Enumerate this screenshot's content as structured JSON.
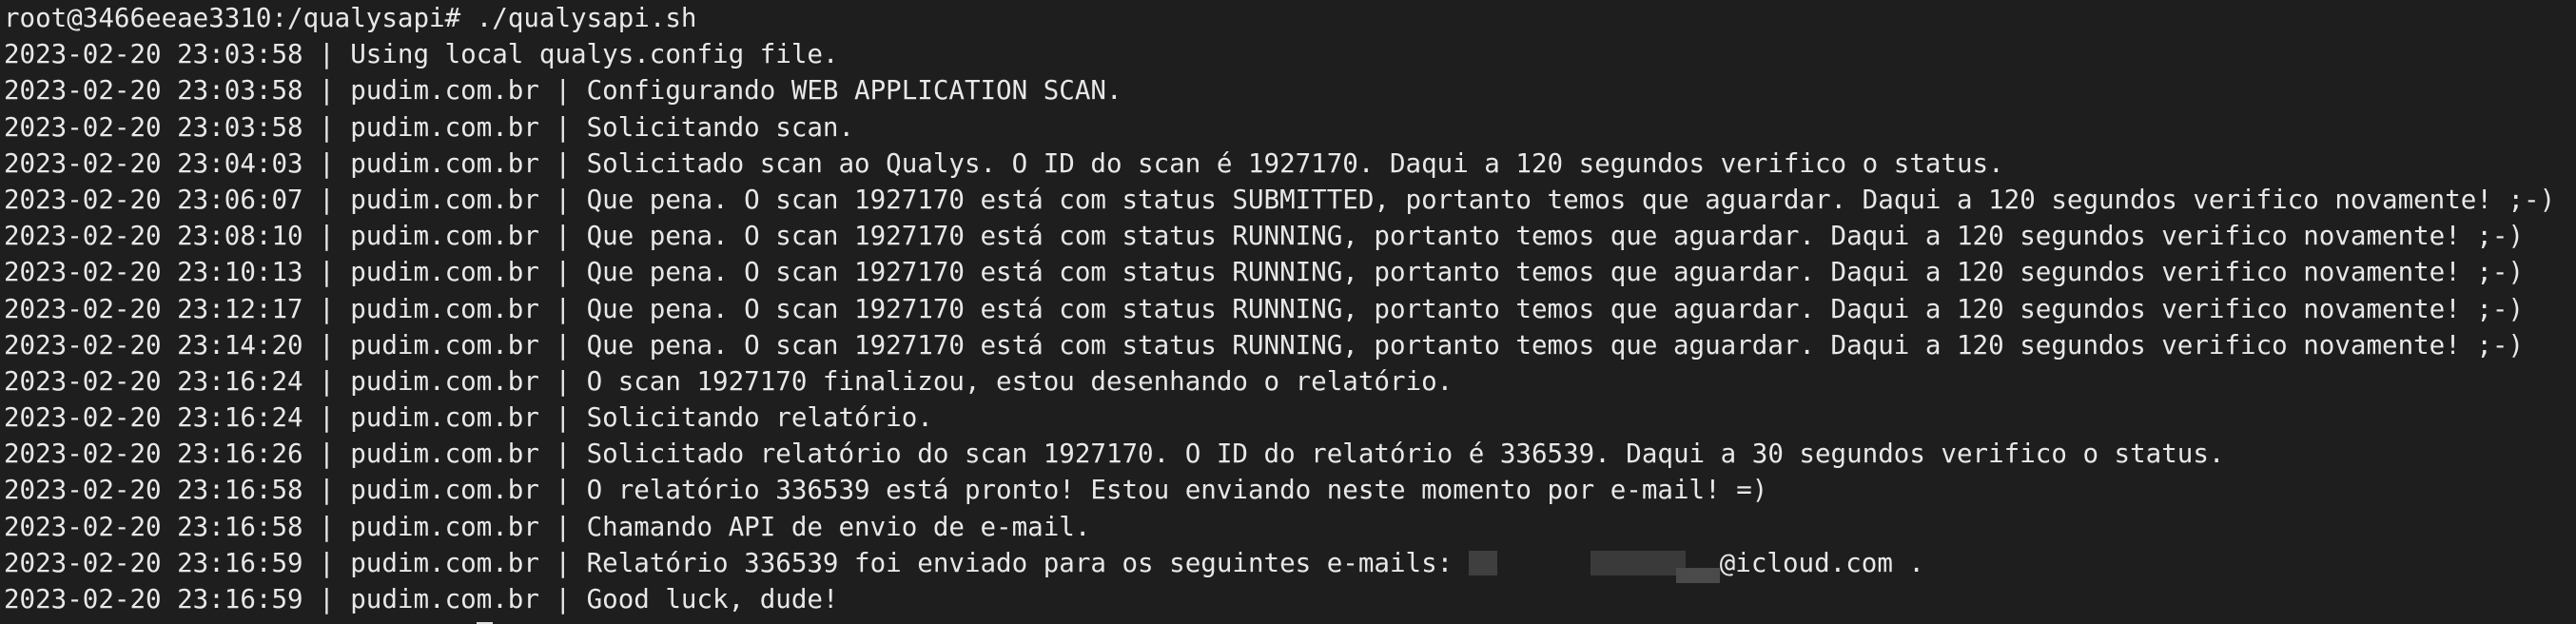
{
  "terminal": {
    "command_line": {
      "prompt": "root@3466eeae3310:/qualysapi# ",
      "command": "./qualysapi.sh"
    },
    "lines": [
      "2023-02-20 23:03:58 | Using local qualys.config file.",
      "2023-02-20 23:03:58 | pudim.com.br | Configurando WEB APPLICATION SCAN.",
      "2023-02-20 23:03:58 | pudim.com.br | Solicitando scan.",
      "2023-02-20 23:04:03 | pudim.com.br | Solicitado scan ao Qualys. O ID do scan é 1927170. Daqui a 120 segundos verifico o status.",
      "2023-02-20 23:06:07 | pudim.com.br | Que pena. O scan 1927170 está com status SUBMITTED, portanto temos que aguardar. Daqui a 120 segundos verifico novamente! ;-)",
      "2023-02-20 23:08:10 | pudim.com.br | Que pena. O scan 1927170 está com status RUNNING, portanto temos que aguardar. Daqui a 120 segundos verifico novamente! ;-)",
      "2023-02-20 23:10:13 | pudim.com.br | Que pena. O scan 1927170 está com status RUNNING, portanto temos que aguardar. Daqui a 120 segundos verifico novamente! ;-)",
      "2023-02-20 23:12:17 | pudim.com.br | Que pena. O scan 1927170 está com status RUNNING, portanto temos que aguardar. Daqui a 120 segundos verifico novamente! ;-)",
      "2023-02-20 23:14:20 | pudim.com.br | Que pena. O scan 1927170 está com status RUNNING, portanto temos que aguardar. Daqui a 120 segundos verifico novamente! ;-)",
      "2023-02-20 23:16:24 | pudim.com.br | O scan 1927170 finalizou, estou desenhando o relatório.",
      "2023-02-20 23:16:24 | pudim.com.br | Solicitando relatório.",
      "2023-02-20 23:16:26 | pudim.com.br | Solicitado relatório do scan 1927170. O ID do relatório é 336539. Daqui a 30 segundos verifico o status.",
      "2023-02-20 23:16:58 | pudim.com.br | O relatório 336539 está pronto! Estou enviando neste momento por e-mail! =)",
      "2023-02-20 23:16:58 | pudim.com.br | Chamando API de envio de e-mail."
    ],
    "email_line": {
      "prefix": "2023-02-20 23:16:59 | pudim.com.br | Relatório 336539 foi enviado para os seguintes e-mails: ",
      "email_suffix": "@icloud.com ."
    },
    "last_line": "2023-02-20 23:16:59 | pudim.com.br | Good luck, dude!"
  },
  "colors": {
    "background": "#1e1e1e",
    "foreground": "#e8e8e8",
    "cursor": "#e0e0e0"
  }
}
